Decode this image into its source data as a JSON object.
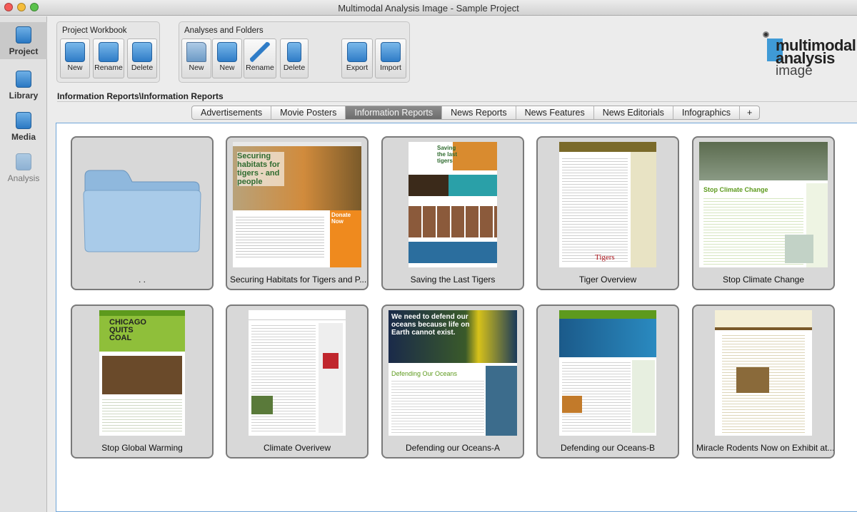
{
  "window": {
    "title": "Multimodal Analysis Image - Sample Project"
  },
  "sidebar": {
    "items": [
      {
        "label": "Project",
        "icon": "project-icon",
        "active": true
      },
      {
        "label": "Library",
        "icon": "library-icon"
      },
      {
        "label": "Media",
        "icon": "media-icon"
      },
      {
        "label": "Analysis",
        "icon": "analysis-icon",
        "disabled": true
      }
    ]
  },
  "toolbar": {
    "workbook": {
      "title": "Project Workbook",
      "buttons": [
        "New",
        "Rename",
        "Delete"
      ]
    },
    "analyses": {
      "title": "Analyses and Folders",
      "buttons": [
        "New",
        "New",
        "Rename",
        "Delete",
        "Export",
        "Import"
      ]
    }
  },
  "logo": {
    "line1": "multimodal",
    "line2": "analysis",
    "line3": "image"
  },
  "breadcrumb": "Information Reports\\Information Reports",
  "tabs": [
    "Advertisements",
    "Movie Posters",
    "Information Reports",
    "News Reports",
    "News Features",
    "News Editorials",
    "Infographics",
    "+"
  ],
  "active_tab": "Information Reports",
  "items": [
    {
      "caption": ". .",
      "type": "folder"
    },
    {
      "caption": "Securing Habitats for Tigers and P...",
      "thumb_title": "Securing habitats for tigers - and people",
      "thumb_side": "Donate Now"
    },
    {
      "caption": "Saving the Last Tigers",
      "thumb_title": "Saving the last tigers"
    },
    {
      "caption": "Tiger Overview",
      "thumb_title": "Tigers"
    },
    {
      "caption": "Stop Climate Change",
      "thumb_title": "Stop Climate Change"
    },
    {
      "caption": "Stop Global Warming",
      "thumb_title": "CHICAGO QUITS COAL"
    },
    {
      "caption": "Climate Overivew"
    },
    {
      "caption": "Defending our Oceans-A",
      "thumb_title": "We need to defend our oceans because life on Earth cannot exist.",
      "thumb_sub": "Defending Our Oceans"
    },
    {
      "caption": "Defending our Oceans-B"
    },
    {
      "caption": "Miracle Rodents Now on Exhibit at..."
    }
  ],
  "colors": {
    "accent": "#2f7cc7",
    "content_border": "#6fa5d8",
    "active_tab": "#7b7b7b"
  }
}
